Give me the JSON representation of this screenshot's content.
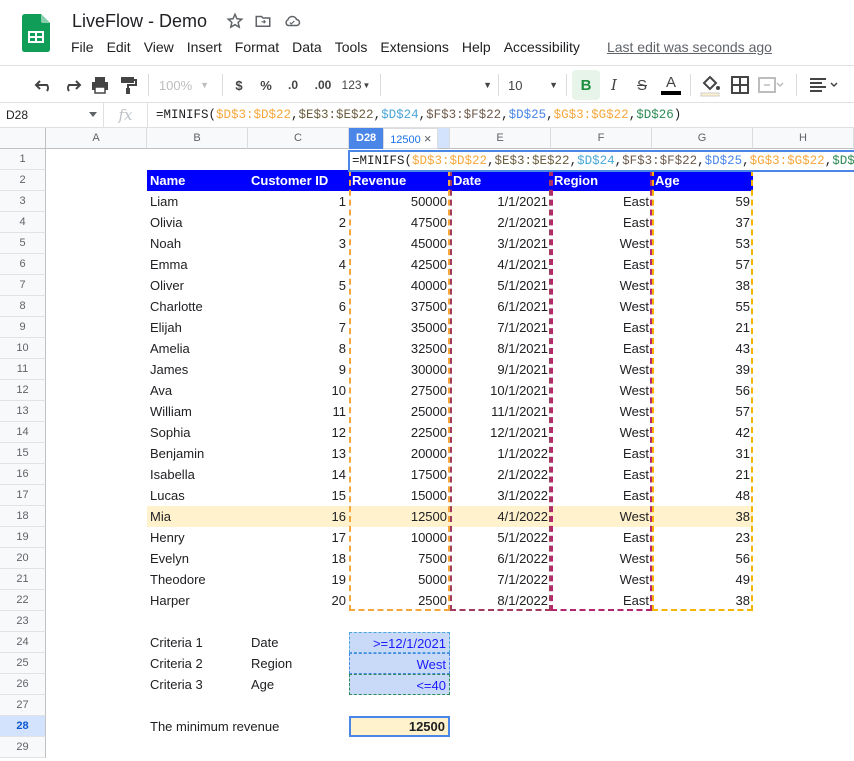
{
  "app": {
    "title": "LiveFlow - Demo",
    "menu": [
      "File",
      "Edit",
      "View",
      "Insert",
      "Format",
      "Data",
      "Tools",
      "Extensions",
      "Help",
      "Accessibility"
    ],
    "last_edit": "Last edit was seconds ago"
  },
  "toolbar": {
    "zoom": "100%",
    "currency": "$",
    "percent": "%",
    "dec_decrease": ".0",
    "dec_increase": ".00",
    "more_formats": "123",
    "font_size": "10",
    "bold": "B",
    "italic": "I",
    "strike": "S",
    "text_color": "A"
  },
  "formula_bar": {
    "name_box": "D28",
    "fx": "fx",
    "formula_parts": [
      "=MINIFS(",
      "$D$3:$D$22",
      ",",
      "$E$3:$E$22",
      ",",
      "$D$24",
      ",",
      "$F$3:$F$22",
      ",",
      "$D$25",
      ",",
      "$G$3:$G$22",
      ",",
      "$D$26",
      ")"
    ]
  },
  "edit_chip": {
    "ref": "D28",
    "value": "12500",
    "close": "×"
  },
  "columns": [
    "A",
    "B",
    "C",
    "D",
    "E",
    "F",
    "G",
    "H"
  ],
  "rows": [
    "1",
    "2",
    "3",
    "4",
    "5",
    "6",
    "7",
    "8",
    "9",
    "10",
    "11",
    "12",
    "13",
    "14",
    "15",
    "16",
    "17",
    "18",
    "19",
    "20",
    "21",
    "22",
    "23",
    "24",
    "25",
    "26",
    "27",
    "28",
    "29"
  ],
  "table": {
    "headers": [
      "Name",
      "Customer ID",
      "Revenue",
      "Date",
      "Region",
      "Age"
    ],
    "rows": [
      [
        "Liam",
        "1",
        "50000",
        "1/1/2021",
        "East",
        "59"
      ],
      [
        "Olivia",
        "2",
        "47500",
        "2/1/2021",
        "East",
        "37"
      ],
      [
        "Noah",
        "3",
        "45000",
        "3/1/2021",
        "West",
        "53"
      ],
      [
        "Emma",
        "4",
        "42500",
        "4/1/2021",
        "East",
        "57"
      ],
      [
        "Oliver",
        "5",
        "40000",
        "5/1/2021",
        "West",
        "38"
      ],
      [
        "Charlotte",
        "6",
        "37500",
        "6/1/2021",
        "West",
        "55"
      ],
      [
        "Elijah",
        "7",
        "35000",
        "7/1/2021",
        "East",
        "21"
      ],
      [
        "Amelia",
        "8",
        "32500",
        "8/1/2021",
        "East",
        "43"
      ],
      [
        "James",
        "9",
        "30000",
        "9/1/2021",
        "West",
        "39"
      ],
      [
        "Ava",
        "10",
        "27500",
        "10/1/2021",
        "West",
        "56"
      ],
      [
        "William",
        "11",
        "25000",
        "11/1/2021",
        "West",
        "57"
      ],
      [
        "Sophia",
        "12",
        "22500",
        "12/1/2021",
        "West",
        "42"
      ],
      [
        "Benjamin",
        "13",
        "20000",
        "1/1/2022",
        "East",
        "31"
      ],
      [
        "Isabella",
        "14",
        "17500",
        "2/1/2022",
        "East",
        "21"
      ],
      [
        "Lucas",
        "15",
        "15000",
        "3/1/2022",
        "East",
        "48"
      ],
      [
        "Mia",
        "16",
        "12500",
        "4/1/2022",
        "West",
        "38"
      ],
      [
        "Henry",
        "17",
        "10000",
        "5/1/2022",
        "East",
        "23"
      ],
      [
        "Evelyn",
        "18",
        "7500",
        "6/1/2022",
        "West",
        "56"
      ],
      [
        "Theodore",
        "19",
        "5000",
        "7/1/2022",
        "West",
        "49"
      ],
      [
        "Harper",
        "20",
        "2500",
        "8/1/2022",
        "East",
        "38"
      ]
    ]
  },
  "criteria": [
    {
      "label": "Criteria 1",
      "field": "Date",
      "value": ">=12/1/2021"
    },
    {
      "label": "Criteria 2",
      "field": "Region",
      "value": "West"
    },
    {
      "label": "Criteria 3",
      "field": "Age",
      "value": "<=40"
    }
  ],
  "result": {
    "label": "The minimum revenue",
    "value": "12500"
  },
  "colors": {
    "header_bg": "#0000ff",
    "highlight": "#fff2cc",
    "criteria_bg": "#c9daf8",
    "accent": "#4a86e8"
  }
}
